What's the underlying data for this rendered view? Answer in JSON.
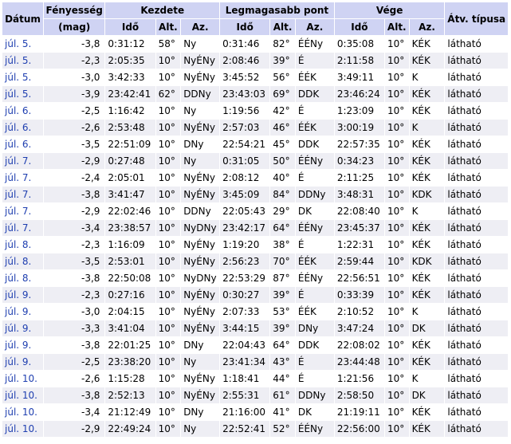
{
  "headers": {
    "datum": "Dátum",
    "mag_top": "Fényesség",
    "mag_bottom": "(mag)",
    "kezdete": "Kezdete",
    "legmagasabb": "Legmagasabb pont",
    "vege": "Vége",
    "tipus": "Átv. típusa",
    "ido": "Idő",
    "alt": "Alt.",
    "az": "Az."
  },
  "rows": [
    {
      "date": "júl. 5.",
      "mag": "-3,8",
      "s_time": "0:31:12",
      "s_alt": "58°",
      "s_az": "Ny",
      "h_time": "0:31:46",
      "h_alt": "82°",
      "h_az": "ÉÉNy",
      "e_time": "0:35:08",
      "e_alt": "10°",
      "e_az": "KÉK",
      "type": "látható"
    },
    {
      "date": "júl. 5.",
      "mag": "-2,3",
      "s_time": "2:05:35",
      "s_alt": "10°",
      "s_az": "NyÉNy",
      "h_time": "2:08:46",
      "h_alt": "39°",
      "h_az": "É",
      "e_time": "2:11:58",
      "e_alt": "10°",
      "e_az": "KÉK",
      "type": "látható"
    },
    {
      "date": "júl. 5.",
      "mag": "-3,0",
      "s_time": "3:42:33",
      "s_alt": "10°",
      "s_az": "NyÉNy",
      "h_time": "3:45:52",
      "h_alt": "56°",
      "h_az": "ÉÉK",
      "e_time": "3:49:11",
      "e_alt": "10°",
      "e_az": "K",
      "type": "látható"
    },
    {
      "date": "júl. 5.",
      "mag": "-3,9",
      "s_time": "23:42:41",
      "s_alt": "62°",
      "s_az": "DDNy",
      "h_time": "23:43:03",
      "h_alt": "69°",
      "h_az": "DDK",
      "e_time": "23:46:24",
      "e_alt": "10°",
      "e_az": "KÉK",
      "type": "látható"
    },
    {
      "date": "júl. 6.",
      "mag": "-2,5",
      "s_time": "1:16:42",
      "s_alt": "10°",
      "s_az": "Ny",
      "h_time": "1:19:56",
      "h_alt": "42°",
      "h_az": "É",
      "e_time": "1:23:09",
      "e_alt": "10°",
      "e_az": "KÉK",
      "type": "látható"
    },
    {
      "date": "júl. 6.",
      "mag": "-2,6",
      "s_time": "2:53:48",
      "s_alt": "10°",
      "s_az": "NyÉNy",
      "h_time": "2:57:03",
      "h_alt": "46°",
      "h_az": "ÉÉK",
      "e_time": "3:00:19",
      "e_alt": "10°",
      "e_az": "K",
      "type": "látható"
    },
    {
      "date": "júl. 6.",
      "mag": "-3,5",
      "s_time": "22:51:09",
      "s_alt": "10°",
      "s_az": "DNy",
      "h_time": "22:54:21",
      "h_alt": "45°",
      "h_az": "DDK",
      "e_time": "22:57:35",
      "e_alt": "10°",
      "e_az": "KÉK",
      "type": "látható"
    },
    {
      "date": "júl. 7.",
      "mag": "-2,9",
      "s_time": "0:27:48",
      "s_alt": "10°",
      "s_az": "Ny",
      "h_time": "0:31:05",
      "h_alt": "50°",
      "h_az": "ÉÉNy",
      "e_time": "0:34:23",
      "e_alt": "10°",
      "e_az": "KÉK",
      "type": "látható"
    },
    {
      "date": "júl. 7.",
      "mag": "-2,4",
      "s_time": "2:05:01",
      "s_alt": "10°",
      "s_az": "NyÉNy",
      "h_time": "2:08:12",
      "h_alt": "40°",
      "h_az": "É",
      "e_time": "2:11:25",
      "e_alt": "10°",
      "e_az": "KÉK",
      "type": "látható"
    },
    {
      "date": "júl. 7.",
      "mag": "-3,8",
      "s_time": "3:41:47",
      "s_alt": "10°",
      "s_az": "NyÉNy",
      "h_time": "3:45:09",
      "h_alt": "84°",
      "h_az": "DDNy",
      "e_time": "3:48:31",
      "e_alt": "10°",
      "e_az": "KDK",
      "type": "látható"
    },
    {
      "date": "júl. 7.",
      "mag": "-2,9",
      "s_time": "22:02:46",
      "s_alt": "10°",
      "s_az": "DDNy",
      "h_time": "22:05:43",
      "h_alt": "29°",
      "h_az": "DK",
      "e_time": "22:08:40",
      "e_alt": "10°",
      "e_az": "K",
      "type": "látható"
    },
    {
      "date": "júl. 7.",
      "mag": "-3,4",
      "s_time": "23:38:57",
      "s_alt": "10°",
      "s_az": "NyDNy",
      "h_time": "23:42:17",
      "h_alt": "64°",
      "h_az": "ÉÉNy",
      "e_time": "23:45:37",
      "e_alt": "10°",
      "e_az": "KÉK",
      "type": "látható"
    },
    {
      "date": "júl. 8.",
      "mag": "-2,3",
      "s_time": "1:16:09",
      "s_alt": "10°",
      "s_az": "NyÉNy",
      "h_time": "1:19:20",
      "h_alt": "38°",
      "h_az": "É",
      "e_time": "1:22:31",
      "e_alt": "10°",
      "e_az": "KÉK",
      "type": "látható"
    },
    {
      "date": "júl. 8.",
      "mag": "-3,5",
      "s_time": "2:53:01",
      "s_alt": "10°",
      "s_az": "NyÉNy",
      "h_time": "2:56:23",
      "h_alt": "70°",
      "h_az": "ÉÉK",
      "e_time": "2:59:44",
      "e_alt": "10°",
      "e_az": "KDK",
      "type": "látható"
    },
    {
      "date": "júl. 8.",
      "mag": "-3,8",
      "s_time": "22:50:08",
      "s_alt": "10°",
      "s_az": "NyDNy",
      "h_time": "22:53:29",
      "h_alt": "87°",
      "h_az": "ÉÉNy",
      "e_time": "22:56:51",
      "e_alt": "10°",
      "e_az": "KÉK",
      "type": "látható"
    },
    {
      "date": "júl. 9.",
      "mag": "-2,3",
      "s_time": "0:27:16",
      "s_alt": "10°",
      "s_az": "NyÉNy",
      "h_time": "0:30:27",
      "h_alt": "39°",
      "h_az": "É",
      "e_time": "0:33:39",
      "e_alt": "10°",
      "e_az": "KÉK",
      "type": "látható"
    },
    {
      "date": "júl. 9.",
      "mag": "-3,0",
      "s_time": "2:04:15",
      "s_alt": "10°",
      "s_az": "NyÉNy",
      "h_time": "2:07:33",
      "h_alt": "53°",
      "h_az": "ÉÉK",
      "e_time": "2:10:52",
      "e_alt": "10°",
      "e_az": "K",
      "type": "látható"
    },
    {
      "date": "júl. 9.",
      "mag": "-3,3",
      "s_time": "3:41:04",
      "s_alt": "10°",
      "s_az": "NyÉNy",
      "h_time": "3:44:15",
      "h_alt": "39°",
      "h_az": "DNy",
      "e_time": "3:47:24",
      "e_alt": "10°",
      "e_az": "DK",
      "type": "látható"
    },
    {
      "date": "júl. 9.",
      "mag": "-3,8",
      "s_time": "22:01:25",
      "s_alt": "10°",
      "s_az": "DNy",
      "h_time": "22:04:43",
      "h_alt": "64°",
      "h_az": "DDK",
      "e_time": "22:08:02",
      "e_alt": "10°",
      "e_az": "KÉK",
      "type": "látható"
    },
    {
      "date": "júl. 9.",
      "mag": "-2,5",
      "s_time": "23:38:20",
      "s_alt": "10°",
      "s_az": "Ny",
      "h_time": "23:41:34",
      "h_alt": "43°",
      "h_az": "É",
      "e_time": "23:44:48",
      "e_alt": "10°",
      "e_az": "KÉK",
      "type": "látható"
    },
    {
      "date": "júl. 10.",
      "mag": "-2,6",
      "s_time": "1:15:28",
      "s_alt": "10°",
      "s_az": "NyÉNy",
      "h_time": "1:18:41",
      "h_alt": "44°",
      "h_az": "É",
      "e_time": "1:21:56",
      "e_alt": "10°",
      "e_az": "K",
      "type": "látható"
    },
    {
      "date": "júl. 10.",
      "mag": "-3,8",
      "s_time": "2:52:13",
      "s_alt": "10°",
      "s_az": "NyÉNy",
      "h_time": "2:55:31",
      "h_alt": "61°",
      "h_az": "DDNy",
      "e_time": "2:58:50",
      "e_alt": "10°",
      "e_az": "DK",
      "type": "látható"
    },
    {
      "date": "júl. 10.",
      "mag": "-3,4",
      "s_time": "21:12:49",
      "s_alt": "10°",
      "s_az": "DNy",
      "h_time": "21:16:00",
      "h_alt": "41°",
      "h_az": "DK",
      "e_time": "21:19:11",
      "e_alt": "10°",
      "e_az": "KÉK",
      "type": "látható"
    },
    {
      "date": "júl. 10.",
      "mag": "-2,9",
      "s_time": "22:49:24",
      "s_alt": "10°",
      "s_az": "Ny",
      "h_time": "22:52:41",
      "h_alt": "52°",
      "h_az": "ÉÉNy",
      "e_time": "22:56:00",
      "e_alt": "10°",
      "e_az": "KÉK",
      "type": "látható"
    }
  ]
}
